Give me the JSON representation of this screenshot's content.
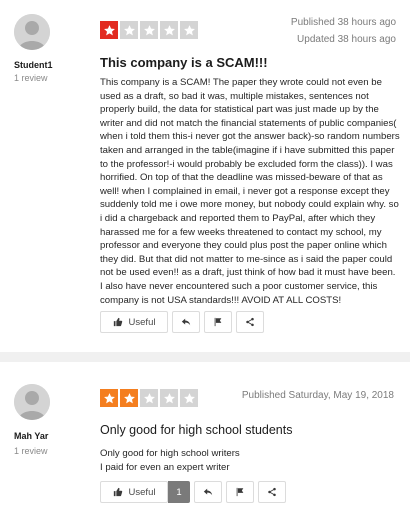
{
  "colors": {
    "star_1": "#e22b21",
    "star_2": "#f47e1f",
    "star_empty": "#d4d4d4",
    "count_bg": "#7a7a7a"
  },
  "reviews": [
    {
      "username": "Student1",
      "review_count": "1 review",
      "rating": 1,
      "published": "Published 38 hours ago",
      "updated": "Updated 38 hours ago",
      "title": "This company is a SCAM!!!",
      "body": "This company is a SCAM! The paper they wrote could not even be used as a draft, so bad it was, multiple mistakes, sentences not properly build, the data for statistical part was just made up by the writer and did not match the financial statements of public companies( when i told them this-i never got the answer back)-so random numbers taken and arranged in the table(imagine if i have submitted this paper to the professor!-i would probably be excluded form the class)). I was horrified. On top of that the deadline was missed-beware of that as well! when I complained in email, i never got a response except they suddenly told me i owe more money, but nobody could explain why. so i did a chargeback and reported them to PayPal, after which they harassed me for a few weeks threatened to contact my school, my professor and everyone they could plus post the paper online which they did. But that did not matter to me-since as i said the paper could not be used even!! as a draft, just think of how bad it must have been. I also have never encountered such a poor customer service, this company is not USA standards!!! AVOID AT ALL COSTS!",
      "useful_label": "Useful",
      "icons": [
        "thumbs-up-icon",
        "reply-icon",
        "flag-icon",
        "share-icon"
      ]
    },
    {
      "username": "Mah Yar",
      "review_count": "1 review",
      "rating": 2,
      "published": "Published Saturday, May 19, 2018",
      "title": "Only good for high school students",
      "body_line1": "Only good for high school writers",
      "body_line2": "I paid for even an expert writer",
      "useful_label": "Useful",
      "useful_count": "1",
      "icons": [
        "thumbs-up-icon",
        "reply-icon",
        "flag-icon",
        "share-icon"
      ]
    }
  ]
}
